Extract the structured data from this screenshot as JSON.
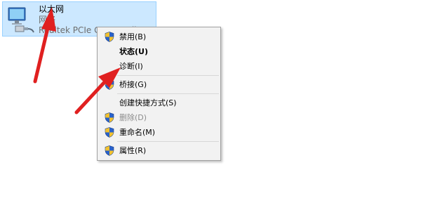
{
  "adapter": {
    "name": "以太网",
    "status": "网络",
    "device": "Realtek PCIe GBE Family Controller"
  },
  "context_menu": {
    "items": [
      {
        "label": "禁用(B)",
        "icon": "uac-shield-icon"
      },
      {
        "label": "状态(U)",
        "bold": true
      },
      {
        "label": "诊断(I)"
      },
      {
        "label": "桥接(G)",
        "icon": "uac-shield-icon"
      },
      {
        "label": "创建快捷方式(S)"
      },
      {
        "label": "删除(D)",
        "icon": "uac-shield-icon",
        "disabled": true
      },
      {
        "label": "重命名(M)",
        "icon": "uac-shield-icon"
      },
      {
        "label": "属性(R)",
        "icon": "uac-shield-icon"
      }
    ]
  },
  "colors": {
    "selection_bg": "#cce8ff",
    "selection_border": "#99d1ff",
    "menu_bg": "#f2f2f2",
    "annotation": "#e02020",
    "shield_blue": "#2a62c9",
    "shield_yellow": "#f2c12e"
  }
}
